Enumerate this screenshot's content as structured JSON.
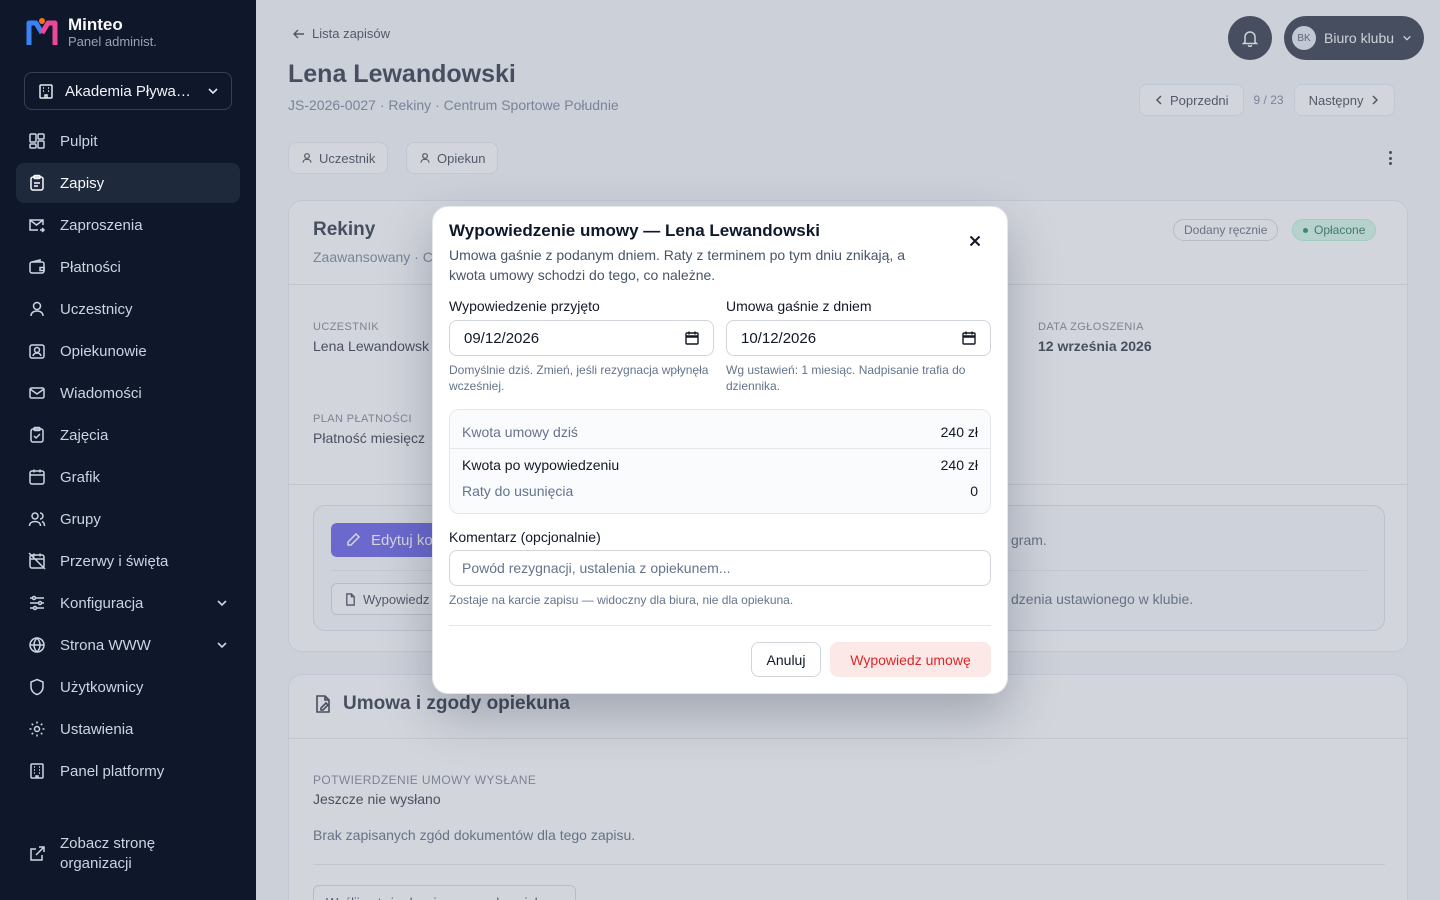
{
  "brand": {
    "name": "Minteo",
    "subtitle": "Panel administ."
  },
  "org_select": {
    "value": "Akademia Pływani..."
  },
  "sidebar": {
    "items": [
      {
        "label": "Pulpit",
        "icon": "dashboard-icon"
      },
      {
        "label": "Zapisy",
        "icon": "clipboard-icon",
        "active": true
      },
      {
        "label": "Zaproszenia",
        "icon": "mail-send-icon"
      },
      {
        "label": "Płatności",
        "icon": "wallet-icon"
      },
      {
        "label": "Uczestnicy",
        "icon": "user-icon"
      },
      {
        "label": "Opiekunowie",
        "icon": "guardian-icon"
      },
      {
        "label": "Wiadomości",
        "icon": "mail-icon"
      },
      {
        "label": "Zajęcia",
        "icon": "clipboard-check-icon"
      },
      {
        "label": "Grafik",
        "icon": "calendar-icon"
      },
      {
        "label": "Grupy",
        "icon": "users-icon"
      },
      {
        "label": "Przerwy i święta",
        "icon": "calendar-off-icon"
      },
      {
        "label": "Konfiguracja",
        "icon": "sliders-icon",
        "expandable": true
      },
      {
        "label": "Strona WWW",
        "icon": "globe-icon",
        "expandable": true
      },
      {
        "label": "Użytkownicy",
        "icon": "shield-icon"
      },
      {
        "label": "Ustawienia",
        "icon": "gear-icon"
      },
      {
        "label": "Panel platformy",
        "icon": "building-icon"
      }
    ],
    "bottom_link": {
      "line1": "Zobacz stronę",
      "line2": "organizacji"
    }
  },
  "header": {
    "back_link": "Lista zapisów",
    "title": "Lena Lewandowski",
    "subtitle": "JS-2026-0027 · Rekiny · Centrum Sportowe Południe",
    "user": {
      "initials": "BK",
      "label": "Biuro klubu"
    },
    "pager": {
      "prev": "Poprzedni",
      "count": "9 / 23",
      "next": "Następny"
    },
    "chips": {
      "participant": "Uczestnik",
      "guardian": "Opiekun"
    }
  },
  "card1": {
    "title": "Rekiny",
    "subtitle": "Zaawansowany · C",
    "badges": {
      "manual": "Dodany ręcznie",
      "paid": "Opłacone"
    },
    "fields": {
      "participant_label": "Uczestnik",
      "participant_value": "Lena Lewandowsk",
      "date_label": "Data zgłoszenia",
      "date_value": "12 września 2026",
      "plan_label": "Plan płatności",
      "plan_value": "Płatność miesięcz"
    },
    "actions": {
      "edit_label": "Edytuj ko",
      "edit_hint": "gram.",
      "resign_label": "Wypowiedz",
      "resign_hint": "dzenia ustawionego w klubie."
    }
  },
  "card2": {
    "title": "Umowa i zgody opiekuna",
    "confirm_label": "Potwierdzenie umowy wysłane",
    "confirm_value": "Jeszcze nie wysłano",
    "no_consents": "Brak zapisanych zgód dokumentów dla tego zapisu.",
    "send_button": "Wyślij potwierdzenie umowy do opiekuna"
  },
  "modal": {
    "title": "Wypowiedzenie umowy — Lena Lewandowski",
    "description": "Umowa gaśnie z podanym dniem. Raty z terminem po tym dniu znikają, a kwota umowy schodzi do tego, co należne.",
    "accepted": {
      "label": "Wypowiedzenie przyjęto",
      "value": "09/12/2026",
      "help": "Domyślnie dziś. Zmień, jeśli rezygnacja wpłynęła wcześniej."
    },
    "expires": {
      "label": "Umowa gaśnie z dniem",
      "value": "10/12/2026",
      "help": "Wg ustawień: 1 miesiąc. Nadpisanie trafia do dziennika."
    },
    "summary": {
      "today_label": "Kwota umowy dziś",
      "today_value": "240 zł",
      "after_label": "Kwota po wypowiedzeniu",
      "after_value": "240 zł",
      "remove_label": "Raty do usunięcia",
      "remove_value": "0"
    },
    "comment": {
      "label": "Komentarz (opcjonalnie)",
      "placeholder": "Powód rezygnacji, ustalenia z opiekunem...",
      "help": "Zostaje na karcie zapisu — widoczny dla biura, nie dla opiekuna."
    },
    "cancel": "Anuluj",
    "confirm": "Wypowiedz umowę"
  },
  "colors": {
    "sidebar_bg": "#0f172a",
    "accent": "#4f46e5",
    "paid_badge": "#d1fae5",
    "danger": "#dc2626"
  }
}
